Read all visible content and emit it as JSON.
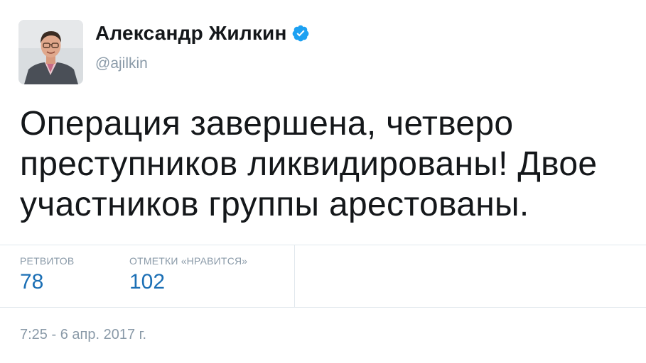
{
  "author": {
    "name": "Александр Жилкин",
    "handle": "@ajilkin",
    "verified": true,
    "avatar_icon": "profile-photo"
  },
  "tweet": {
    "text": "Операция завершена, четверо преступников ликвидированы! Двое участников группы арестованы."
  },
  "stats": {
    "retweets_label": "РЕТВИТОВ",
    "retweets_count": "78",
    "likes_label": "ОТМЕТКИ «НРАВИТСЯ»",
    "likes_count": "102"
  },
  "timestamp": "7:25 - 6 апр. 2017 г.",
  "colors": {
    "text": "#14171a",
    "muted": "#8a9aa8",
    "accent": "#1b6fb5",
    "verified": "#1da1f2",
    "border": "#e1e8ed"
  }
}
